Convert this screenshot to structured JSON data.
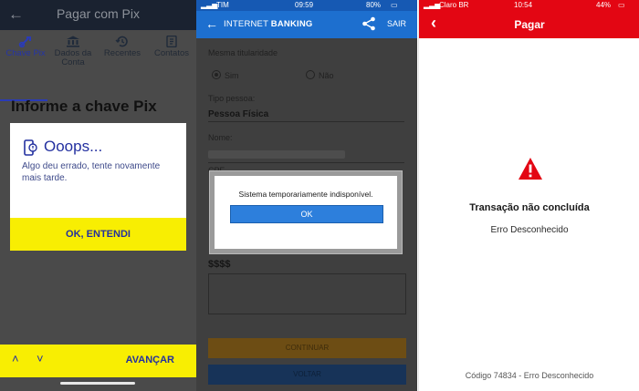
{
  "panel1": {
    "header_title": "Pagar com Pix",
    "tabs": [
      {
        "label": "Chave Pix",
        "icon": "pix-key-icon"
      },
      {
        "label": "Dados da Conta",
        "icon": "bank-icon"
      },
      {
        "label": "Recentes",
        "icon": "history-icon"
      },
      {
        "label": "Contatos",
        "icon": "contacts-icon"
      }
    ],
    "heading": "Informe a chave Pix",
    "modal": {
      "title": "Ooops...",
      "message": "Algo deu errado, tente novamente mais tarde.",
      "button": "OK, ENTENDI"
    },
    "bottom": {
      "prev_symbol": "˄",
      "next_symbol": "˅",
      "next_label": "AVANÇAR"
    },
    "colors": {
      "brand_yellow": "#f8ee02",
      "brand_blue": "#2330a0"
    }
  },
  "panel2": {
    "status": {
      "carrier": "TIM",
      "time": "09:59",
      "battery": "80%"
    },
    "header": {
      "title_prefix": "INTERNET ",
      "title_bold": "BANKING",
      "exit": "SAIR"
    },
    "fields": {
      "same_owner_label": "Mesma titularidade",
      "yes": "Sim",
      "no": "Não",
      "person_type_label": "Tipo pessoa:",
      "person_type_value": "Pessoa Física",
      "name_label": "Nome:",
      "cpf_label": "CPF",
      "amount_value": "$$$$"
    },
    "dialog": {
      "message": "Sistema temporariamente indisponível.",
      "ok": "OK"
    },
    "buttons": {
      "continue": "CONTINUAR",
      "back": "VOLTAR"
    },
    "colors": {
      "accent_blue": "#1d6fcf"
    }
  },
  "panel3": {
    "status": {
      "carrier": "Claro BR",
      "time": "10:54",
      "battery": "44%"
    },
    "header_title": "Pagar",
    "error_title": "Transação não concluída",
    "error_subtitle": "Erro Desconhecido",
    "error_code": "Código 74834 - Erro Desconhecido",
    "colors": {
      "brand_red": "#e30613"
    }
  }
}
